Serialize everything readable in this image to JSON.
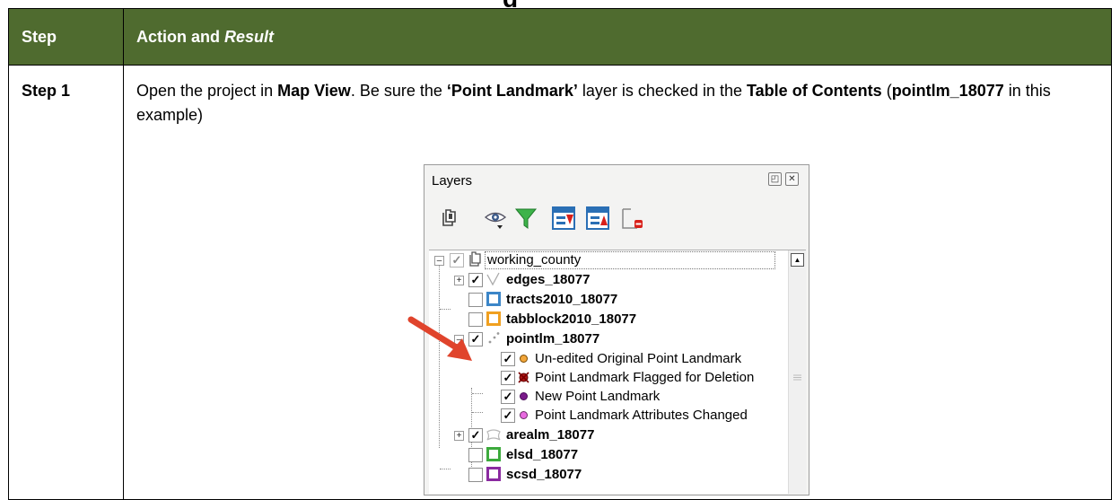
{
  "doc": {
    "header": {
      "step": "Step",
      "action": "Action and ",
      "result": "Result"
    },
    "row": {
      "step": "Step 1",
      "t1": "Open the project in ",
      "b1": "Map View",
      "t2": ". Be sure the ",
      "b2": "‘Point Landmark’",
      "t3": " layer is checked in the ",
      "b3": "Table of Contents",
      "t4": " (",
      "b4": "pointlm_18077",
      "t5": " in this example)"
    }
  },
  "colors": {
    "header_bg": "#4f6b2f",
    "arrow": "#e0442c",
    "tracts": "#3c86c8",
    "tabblock": "#f0a020",
    "arealm_outline": "#b8b8b8",
    "elsd": "#3caa3c",
    "scsd": "#8a2aa0"
  },
  "layers_panel": {
    "title": "Layers",
    "window_buttons": [
      "float-icon",
      "close-icon"
    ],
    "toolbar": [
      "add-group-icon",
      "visibility-eye-icon",
      "filter-funnel-icon",
      "expand-all-icon",
      "collapse-all-icon",
      "remove-layer-icon"
    ],
    "group": {
      "label": "working_county",
      "checked": true
    },
    "layers": [
      {
        "label": "edges_18077",
        "checked": true,
        "expandable": true,
        "icon": "line-layer-icon"
      },
      {
        "label": "tracts2010_18077",
        "checked": false,
        "expandable": false,
        "icon": "tracts-polygon-icon"
      },
      {
        "label": "tabblock2010_18077",
        "checked": false,
        "expandable": false,
        "icon": "tabblock-polygon-icon"
      },
      {
        "label": "pointlm_18077",
        "checked": true,
        "expandable": true,
        "icon": "point-layer-icon"
      },
      {
        "label": "arealm_18077",
        "checked": true,
        "expandable": true,
        "icon": "arealm-polygon-icon"
      },
      {
        "label": "elsd_18077",
        "checked": false,
        "expandable": false,
        "icon": "elsd-polygon-icon"
      },
      {
        "label": "scsd_18077",
        "checked": false,
        "expandable": false,
        "icon": "scsd-polygon-icon"
      }
    ],
    "legend": [
      {
        "label": "Un-edited Original Point Landmark",
        "checked": true,
        "fill": "#f2a63a",
        "stroke": "#7a4a00"
      },
      {
        "label": "Point Landmark Flagged for Deletion",
        "checked": true,
        "fill": "#b01818",
        "stroke": "#5a0000",
        "cross": true
      },
      {
        "label": "New Point Landmark",
        "checked": true,
        "fill": "#7a1a8a",
        "stroke": "#4a0a5a"
      },
      {
        "label": "Point Landmark Attributes Changed",
        "checked": true,
        "fill": "#e86ae0",
        "stroke": "#6a2a66"
      }
    ]
  }
}
